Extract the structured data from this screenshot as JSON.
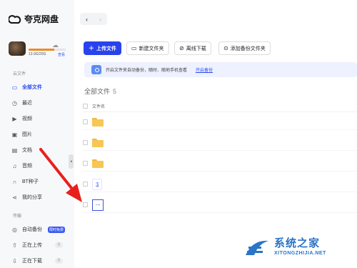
{
  "app": {
    "name": "夸克网盘"
  },
  "user": {
    "storage_text": "13.9G/20G",
    "storage_link": "查看",
    "storage_used": 0.695
  },
  "sidebar": {
    "section1": "云文件",
    "items": [
      {
        "label": "全部文件",
        "icon": "folder-icon",
        "active": true
      },
      {
        "label": "最近",
        "icon": "clock-icon"
      },
      {
        "label": "视频",
        "icon": "video-icon"
      },
      {
        "label": "图片",
        "icon": "image-icon"
      },
      {
        "label": "文档",
        "icon": "document-icon"
      },
      {
        "label": "音频",
        "icon": "headphones-icon"
      },
      {
        "label": "BT种子",
        "icon": "magnet-icon"
      },
      {
        "label": "我的分享",
        "icon": "share-icon"
      }
    ],
    "section2": "传输",
    "transfer": [
      {
        "label": "自动备份",
        "badge": "限时免费",
        "icon": "backup-icon"
      },
      {
        "label": "正在上传",
        "count": "0",
        "icon": "upload-icon"
      },
      {
        "label": "正在下载",
        "count": "0",
        "icon": "download-icon"
      }
    ]
  },
  "toolbar": {
    "upload": "上传文件",
    "new_folder": "新建文件夹",
    "offline_download": "离线下载",
    "add_backup": "添加备份文件夹"
  },
  "notice": {
    "text": "开启文件夹自动备份，随时、随地手机查看",
    "link": "开启备份"
  },
  "files": {
    "title": "全部文件",
    "count": "5",
    "column_name": "文件名",
    "rows": [
      {
        "type": "folder"
      },
      {
        "type": "folder"
      },
      {
        "type": "folder"
      },
      {
        "type": "document"
      },
      {
        "type": "image"
      }
    ]
  },
  "watermark": {
    "title": "系统之家",
    "url": "XITONGZHIJIA.NET"
  },
  "colors": {
    "accent": "#2842ee",
    "arrow": "#e8201c",
    "folder": "#f7c654",
    "watermark": "#2b74c8"
  }
}
